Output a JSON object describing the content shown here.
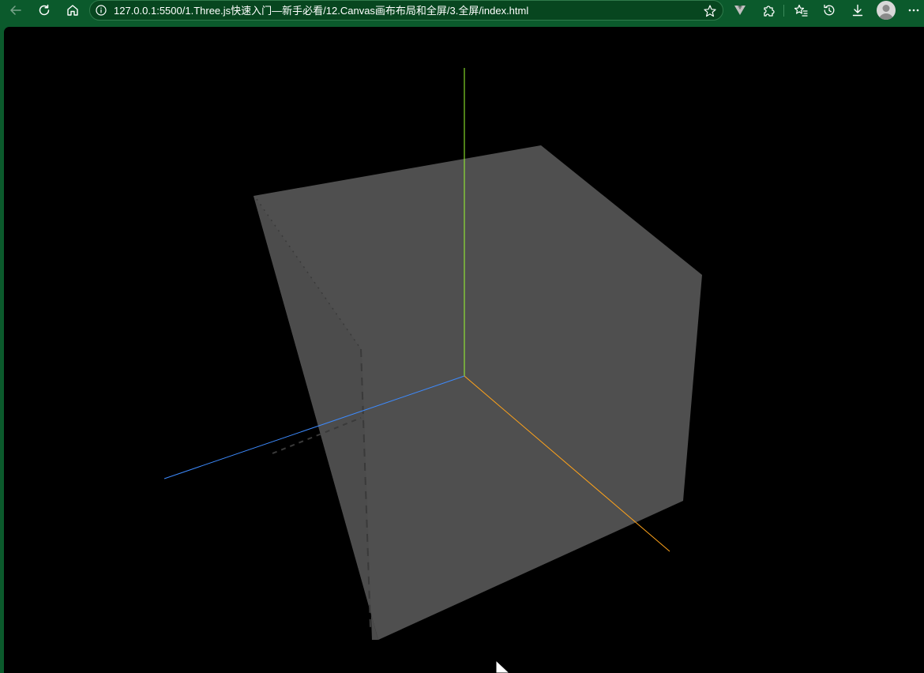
{
  "browser": {
    "url": "127.0.0.1:5500/1.Three.js快速入门—新手必看/12.Canvas画布布局和全屏/3.全屏/index.html",
    "icons": {
      "back": "arrow-left-icon",
      "refresh": "refresh-icon",
      "home": "home-icon",
      "site_info": "info-icon",
      "favorite": "star-icon",
      "extension_vue": "vue-devtools-icon",
      "extensions": "puzzle-icon",
      "favorites": "favorites-icon",
      "history": "history-icon",
      "downloads": "download-icon",
      "profile": "avatar",
      "more": "more-icon"
    },
    "colors": {
      "frame": "#0b5a2c",
      "addressbar": "#07461f"
    }
  },
  "scene": {
    "description_free": true,
    "background": "#000000",
    "cube_color": "#4f4f4f",
    "axes": {
      "x_color": "#ffa31a",
      "y_color": "#9bff2f",
      "z_color": "#3d8bff"
    }
  }
}
